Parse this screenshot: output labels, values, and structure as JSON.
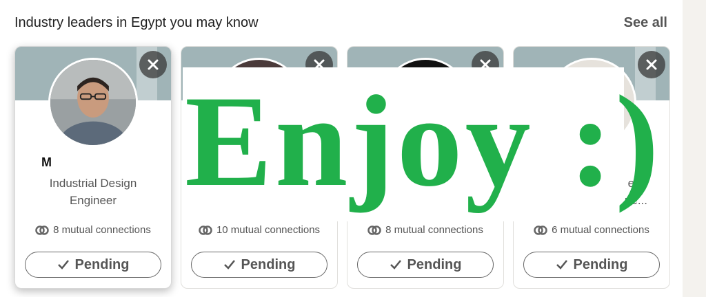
{
  "section": {
    "heading": "Industry leaders in Egypt you may know",
    "see_all": "See all"
  },
  "cards": [
    {
      "name": "M",
      "headline_line1": "Industrial Design",
      "headline_line2": "Engineer",
      "mutual": "8 mutual connections",
      "action": "Pending"
    },
    {
      "name": "",
      "headline_line1": "",
      "headline_line2": "",
      "mutual": "10 mutual connections",
      "action": "Pending"
    },
    {
      "name": "",
      "headline_line1": "",
      "headline_line2": "",
      "mutual": "8 mutual connections",
      "action": "Pending"
    },
    {
      "name": "",
      "headline_line1": "e of",
      "headline_line2": "ure...",
      "mutual": "6 mutual connections",
      "action": "Pending"
    }
  ],
  "overlay": {
    "text": "Enjoy :)"
  },
  "colors": {
    "banner": "#a0b4b7",
    "overlay_text": "#21b04b",
    "dismiss_bg": "#383838"
  },
  "icons": {
    "dismiss": "close-icon",
    "mutual": "mutual-connections-icon",
    "pending": "checkmark-icon"
  }
}
